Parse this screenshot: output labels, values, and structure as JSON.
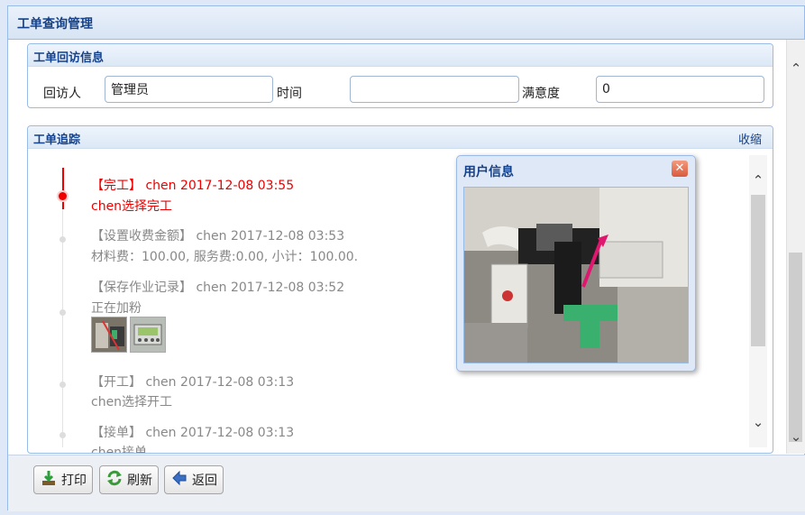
{
  "window": {
    "title": "工单查询管理"
  },
  "visit": {
    "title": "工单回访信息",
    "visitor_label": "回访人",
    "visitor_value": "管理员",
    "time_label": "时间",
    "time_value": "",
    "satisfaction_label": "满意度",
    "satisfaction_value": "0"
  },
  "tracking": {
    "title": "工单追踪",
    "collapse_label": "收缩",
    "events": [
      {
        "head": "【完工】 chen 2017-12-08 03:55",
        "body": "chen选择完工"
      },
      {
        "head": "【设置收费金额】 chen 2017-12-08 03:53",
        "body": "材料费：100.00, 服务费:0.00, 小计：100.00."
      },
      {
        "head": "【保存作业记录】 chen 2017-12-08 03:52",
        "body": "正在加粉"
      },
      {
        "head": "【开工】 chen 2017-12-08 03:13",
        "body": "chen选择开工"
      },
      {
        "head": "【接单】 chen 2017-12-08 03:13",
        "body": "chen接单"
      }
    ]
  },
  "popup": {
    "title": "用户信息",
    "close_icon": "close-icon"
  },
  "toolbar": {
    "print_label": "打印",
    "refresh_label": "刷新",
    "back_label": "返回"
  },
  "colors": {
    "accent": "#15428b",
    "active_event": "#e00000",
    "muted_event": "#888888",
    "border": "#99bbe8"
  }
}
